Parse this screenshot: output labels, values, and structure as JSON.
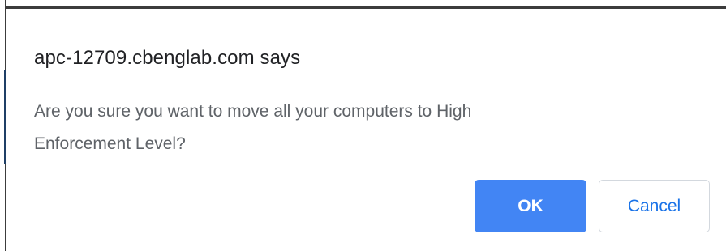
{
  "dialog": {
    "title": "apc-12709.cbenglab.com says",
    "message_line1": "Are you sure you want to move all your computers to High",
    "message_line2": "Enforcement Level?",
    "ok_label": "OK",
    "cancel_label": "Cancel"
  },
  "colors": {
    "ok_button": "#4285f4",
    "cancel_text": "#1a73e8",
    "title_text": "#202124",
    "message_text": "#5f6368"
  }
}
